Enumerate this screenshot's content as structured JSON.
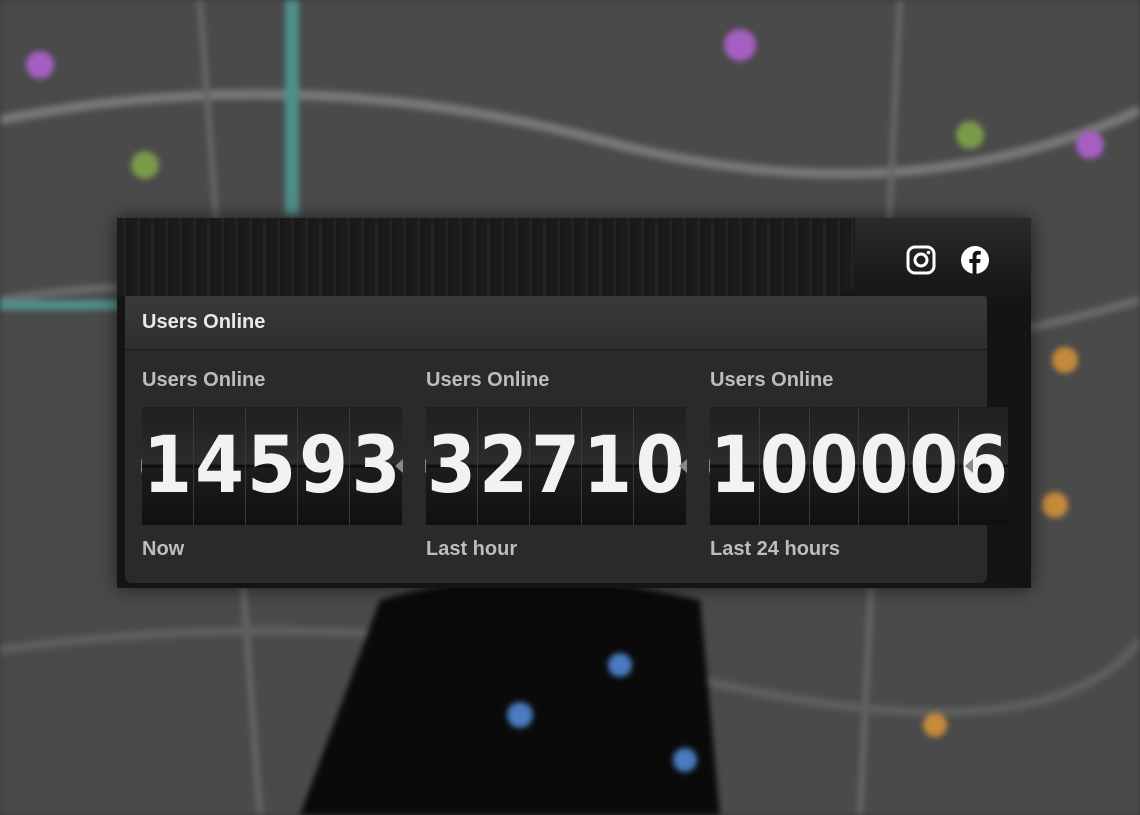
{
  "background": {
    "description_icon": "map-background"
  },
  "social": {
    "icons": [
      "instagram-icon",
      "facebook-icon"
    ]
  },
  "panel": {
    "title": "Users Online"
  },
  "counters": [
    {
      "label": "Users Online",
      "digits": [
        "1",
        "4",
        "5",
        "9",
        "3"
      ],
      "caption": "Now"
    },
    {
      "label": "Users Online",
      "digits": [
        "3",
        "2",
        "7",
        "1",
        "0"
      ],
      "caption": "Last hour"
    },
    {
      "label": "Users Online",
      "digits": [
        "1",
        "0",
        "0",
        "0",
        "0",
        "6"
      ],
      "caption": "Last 24 hours"
    }
  ],
  "colors": {
    "panel": "#2a2a2a",
    "text": "#bdbdbd",
    "title": "#e9e9e9",
    "digit": "#f2f2f2"
  }
}
